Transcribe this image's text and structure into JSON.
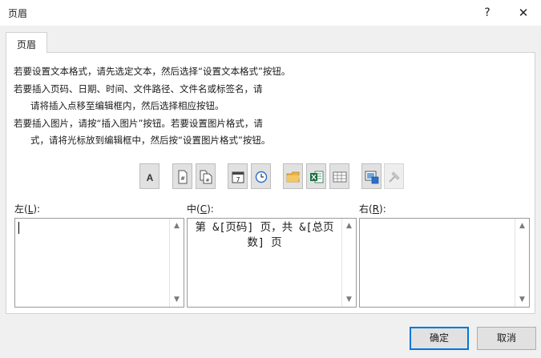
{
  "window": {
    "title": "页眉",
    "help": "?",
    "close": "✕"
  },
  "tabs": [
    {
      "label": "页眉"
    }
  ],
  "instructions": {
    "line1": "若要设置文本格式，请先选定文本，然后选择“设置文本格式”按钮。",
    "line2": "若要插入页码、日期、时间、文件路径、文件名或标签名，请",
    "line3": "请将插入点移至编辑框内，然后选择相应按钮。",
    "line4": "若要插入图片，请按“插入图片”按钮。若要设置图片格式，请",
    "line5": "式，请将光标放到编辑框中，然后按“设置图片格式”按钮。"
  },
  "toolbar": {
    "format_text_glyph": "A",
    "page_number_glyph": "#",
    "page_count_glyph": "#",
    "date_glyph": "7",
    "enabled_state": [
      true,
      true,
      true,
      true,
      true,
      true,
      true,
      true,
      true,
      false
    ]
  },
  "sections": {
    "left": {
      "label_prefix": "左(",
      "accel": "L",
      "label_suffix": "):",
      "content": ""
    },
    "center": {
      "label_prefix": "中(",
      "accel": "C",
      "label_suffix": "):",
      "content_line1": "第 &[页码] 页，共 &[总页",
      "content_line2": "数] 页"
    },
    "right": {
      "label_prefix": "右(",
      "accel": "R",
      "label_suffix": "):",
      "content": ""
    }
  },
  "buttons": {
    "ok": "确定",
    "cancel": "取消"
  },
  "colors": {
    "accent": "#0078d7",
    "excel_green": "#1d6f42",
    "folder_yellow": "#e8b34a"
  }
}
